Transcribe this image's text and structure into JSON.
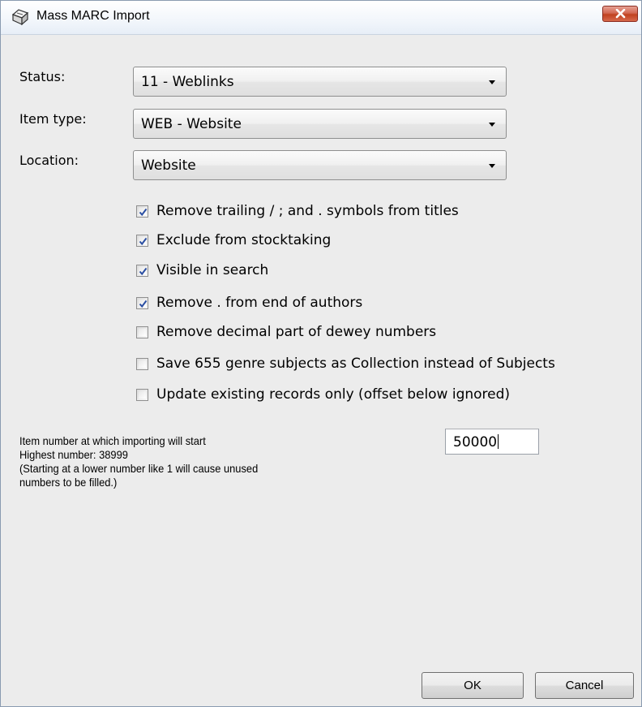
{
  "window": {
    "title": "Mass MARC Import",
    "icon": "import-icon",
    "close_icon": "close-icon"
  },
  "fields": {
    "status": {
      "label": "Status:",
      "value": "11 - Weblinks"
    },
    "item_type": {
      "label": "Item type:",
      "value": "WEB - Website"
    },
    "location": {
      "label": "Location:",
      "value": "Website"
    }
  },
  "options": [
    {
      "label": "Remove trailing / ; and . symbols from titles",
      "checked": true
    },
    {
      "label": "Exclude from stocktaking",
      "checked": true
    },
    {
      "label": "Visible in search",
      "checked": true
    },
    {
      "label": "Remove . from end of authors",
      "checked": true
    },
    {
      "label": "Remove decimal part of dewey numbers",
      "checked": false
    },
    {
      "label": "Save 655 genre subjects as Collection instead of Subjects",
      "checked": false
    },
    {
      "label": "Update existing records only (offset below ignored)",
      "checked": false
    }
  ],
  "start_number": {
    "lines": [
      "Item number at which importing will start",
      "Highest number: 38999",
      "(Starting at a lower number like 1 will cause unused",
      "numbers to be filled.)"
    ],
    "value": "50000"
  },
  "buttons": {
    "ok": "OK",
    "cancel": "Cancel"
  },
  "colors": {
    "close_button": "#c9452a",
    "check_mark": "#2b4fa3"
  }
}
